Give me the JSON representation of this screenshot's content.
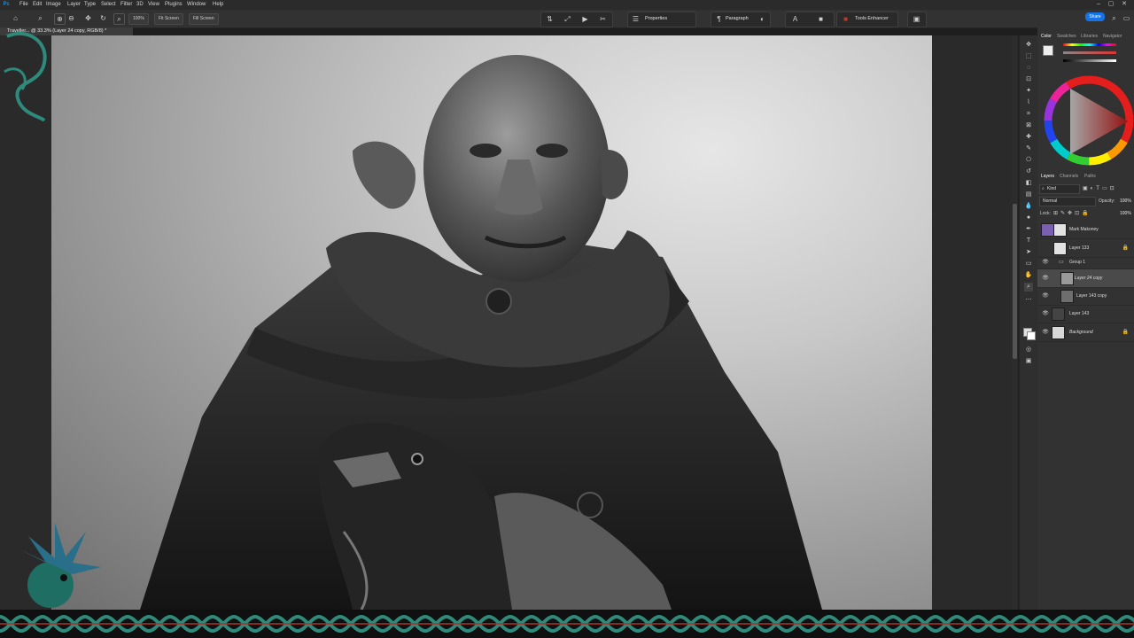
{
  "menu": {
    "items": [
      "File",
      "Edit",
      "Image",
      "Layer",
      "Type",
      "Select",
      "Filter",
      "3D",
      "View",
      "Plugins",
      "Window",
      "Help"
    ]
  },
  "options_bar": {
    "zoom_value": "100%",
    "fit_screen_label": "Fit Screen",
    "fill_screen_label": "Fill Screen"
  },
  "panel_buttons": {
    "properties": "Properties",
    "paragraph": "Paragraph",
    "tools_enhancer": "Tools Enhancer"
  },
  "share_label": "Share",
  "document_tab": {
    "title": "Traveller... @ 33.3% (Layer 24 copy, RGB/8) *"
  },
  "color_panel": {
    "tabs": [
      "Color",
      "Swatches",
      "Libraries",
      "Navigator"
    ],
    "active_tab": "Color"
  },
  "layers_panel": {
    "tabs": [
      "Layers",
      "Channels",
      "Paths"
    ],
    "kind_filter": "Kind",
    "blend_mode": "Normal",
    "opacity_label": "Opacity:",
    "opacity_value": "100%",
    "lock_label": "Lock:",
    "fill_value": "100%",
    "layers": [
      {
        "name": "Mark Makoney",
        "visible": false,
        "locked": false,
        "italic": false,
        "selected": false,
        "thumb": "#7b5fb0"
      },
      {
        "name": "Layer 133",
        "visible": false,
        "locked": true,
        "italic": false,
        "selected": false,
        "thumb": "#e2e2e2"
      },
      {
        "name": "Group 1",
        "visible": true,
        "locked": false,
        "italic": false,
        "selected": false,
        "group": true
      },
      {
        "name": "Layer 24 copy",
        "visible": true,
        "locked": false,
        "italic": true,
        "selected": true,
        "thumb": "#9a9a9a"
      },
      {
        "name": "Layer 143 copy",
        "visible": true,
        "locked": false,
        "italic": false,
        "selected": false,
        "thumb": "#6e6e6e"
      },
      {
        "name": "Layer 143",
        "visible": true,
        "locked": false,
        "italic": false,
        "selected": false,
        "thumb": "#444444"
      },
      {
        "name": "Background",
        "visible": true,
        "locked": true,
        "italic": true,
        "selected": false,
        "thumb": "#d8d8d8"
      }
    ]
  },
  "colors": {
    "accent": "#1473e6",
    "tools_enhancer_icon": "#c0392b",
    "border_teal": "#2e8a7a",
    "border_red": "#a8322a"
  }
}
